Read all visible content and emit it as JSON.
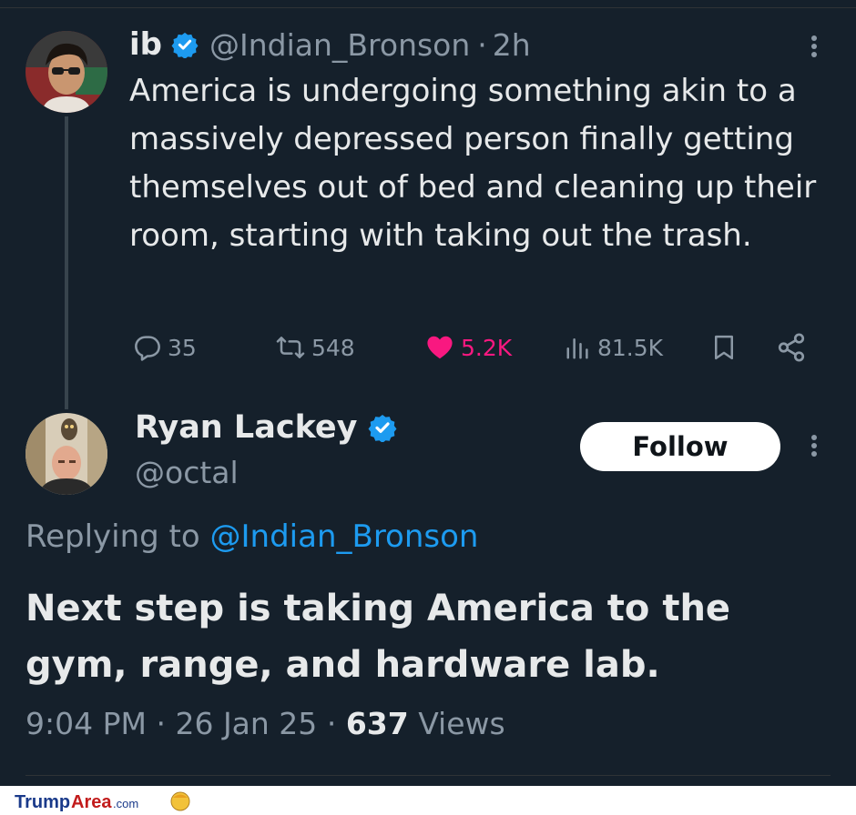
{
  "original_tweet": {
    "display_name": "ib",
    "handle": "@Indian_Bronson",
    "separator": "·",
    "time": "2h",
    "text": "America is undergoing something akin to a massively depressed person finally getting themselves out of bed and cleaning up their room, starting with taking out the trash.",
    "verified": true,
    "actions": {
      "replies": "35",
      "retweets": "548",
      "likes": "5.2K",
      "views": "81.5K"
    }
  },
  "reply_tweet": {
    "display_name": "Ryan Lackey",
    "handle": "@octal",
    "verified": true,
    "follow_label": "Follow",
    "replying_prefix": "Replying to",
    "replying_mention": "@Indian_Bronson",
    "text": "Next step is taking America to the gym, range, and hardware lab.",
    "time": "9:04 PM",
    "date": "26 Jan 25",
    "separator": "·",
    "views_count": "637",
    "views_label": "Views"
  },
  "watermark": {
    "logo": "TrumpArea.com"
  },
  "colors": {
    "background": "#15202b",
    "text": "#e7e9ea",
    "muted": "#8b98a5",
    "accent": "#1d9bf0",
    "like": "#f91880"
  }
}
